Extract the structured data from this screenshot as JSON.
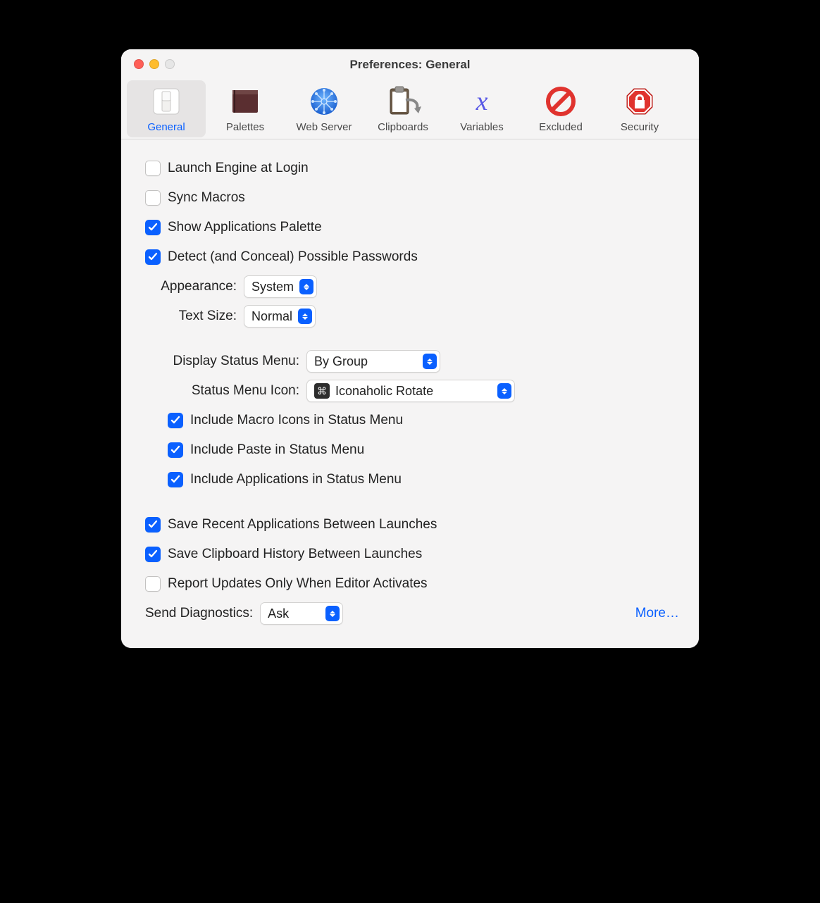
{
  "window": {
    "title": "Preferences: General"
  },
  "tabs": [
    {
      "label": "General"
    },
    {
      "label": "Palettes"
    },
    {
      "label": "Web Server"
    },
    {
      "label": "Clipboards"
    },
    {
      "label": "Variables"
    },
    {
      "label": "Excluded"
    },
    {
      "label": "Security"
    }
  ],
  "opts": {
    "launch_engine": "Launch Engine at Login",
    "sync_macros": "Sync Macros",
    "show_app_pal": "Show Applications Palette",
    "detect_pw": "Detect (and Conceal) Possible Passwords",
    "appearance_lbl": "Appearance:",
    "appearance_val": "System",
    "textsize_lbl": "Text Size:",
    "textsize_val": "Normal",
    "display_sm_lbl": "Display Status Menu:",
    "display_sm_val": "By Group",
    "smicon_lbl": "Status Menu Icon:",
    "smicon_val": "Iconaholic Rotate",
    "inc_macro_icons": "Include Macro Icons in Status Menu",
    "inc_paste": "Include Paste in Status Menu",
    "inc_apps": "Include Applications in Status Menu",
    "save_recent": "Save Recent Applications Between Launches",
    "save_clip": "Save Clipboard History Between Launches",
    "report_updates": "Report Updates Only When Editor Activates",
    "send_diag_lbl": "Send Diagnostics:",
    "send_diag_val": "Ask",
    "more": "More…"
  }
}
